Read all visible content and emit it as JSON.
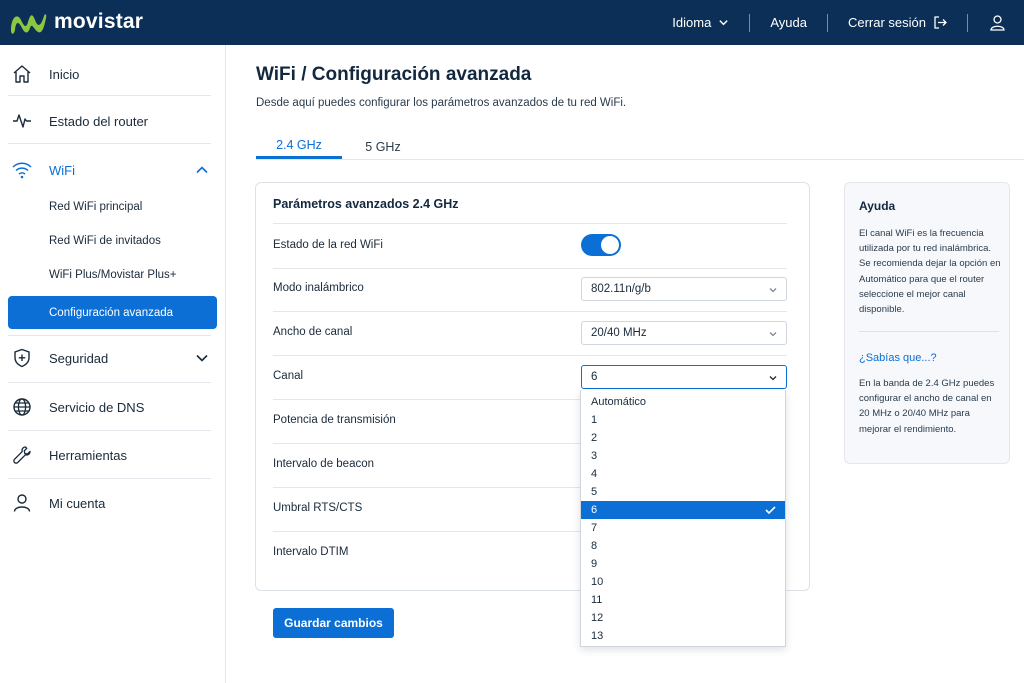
{
  "header": {
    "brand": "movistar",
    "language_label": "Idioma",
    "help_label": "Ayuda",
    "logout_label": "Cerrar sesión"
  },
  "sidebar": {
    "items": [
      {
        "label": "Inicio",
        "icon": "home-icon"
      },
      {
        "label": "Estado del router",
        "icon": "activity-icon"
      },
      {
        "label": "WiFi",
        "icon": "wifi-icon",
        "expanded": true
      },
      {
        "label": "Seguridad",
        "icon": "shield-icon"
      },
      {
        "label": "Servicio de DNS",
        "icon": "globe-icon"
      },
      {
        "label": "Herramientas",
        "icon": "wrench-icon"
      },
      {
        "label": "Mi cuenta",
        "icon": "user-icon"
      }
    ],
    "wifi_sub": [
      {
        "label": "Red WiFi principal"
      },
      {
        "label": "Red WiFi de invitados"
      },
      {
        "label": "WiFi Plus/Movistar Plus+"
      },
      {
        "label": "Configuración avanzada",
        "active": true
      }
    ]
  },
  "main": {
    "title": "WiFi / Configuración avanzada",
    "description": "Desde aquí puedes configurar los parámetros avanzados de tu red WiFi.",
    "tabs": [
      {
        "label": "2.4 GHz",
        "active": true
      },
      {
        "label": "5 GHz"
      }
    ]
  },
  "card": {
    "title": "Parámetros avanzados 2.4 GHz",
    "rows": [
      {
        "label": "Estado de la red WiFi",
        "value": "on"
      },
      {
        "label": "Modo inalámbrico",
        "value": "802.11n/g/b"
      },
      {
        "label": "Ancho de canal",
        "value": "20/40 MHz"
      },
      {
        "label": "Canal",
        "value": "6"
      },
      {
        "label": "Potencia de transmisión"
      },
      {
        "label": "Intervalo de beacon"
      },
      {
        "label": "Umbral RTS/CTS"
      },
      {
        "label": "Intervalo DTIM"
      }
    ]
  },
  "channel_dropdown": {
    "options": [
      "Automático",
      "1",
      "2",
      "3",
      "4",
      "5",
      "6",
      "7",
      "8",
      "9",
      "10",
      "11",
      "12",
      "13"
    ],
    "selected": "6"
  },
  "save_label": "Guardar cambios",
  "help": {
    "title": "Ayuda",
    "text": "El canal WiFi es la frecuencia utilizada por tu red inalámbrica. Se recomienda dejar la opción en Automático para que el router seleccione el mejor canal disponible.",
    "subtitle": "¿Sabías que...?",
    "tip": "En la banda de 2.4 GHz puedes configurar el ancho de canal en 20 MHz o 20/40 MHz para mejorar el rendimiento."
  },
  "colors": {
    "header_bg": "#0b2f57",
    "accent": "#0b6fd6",
    "logo_green": "#8dc63f"
  }
}
